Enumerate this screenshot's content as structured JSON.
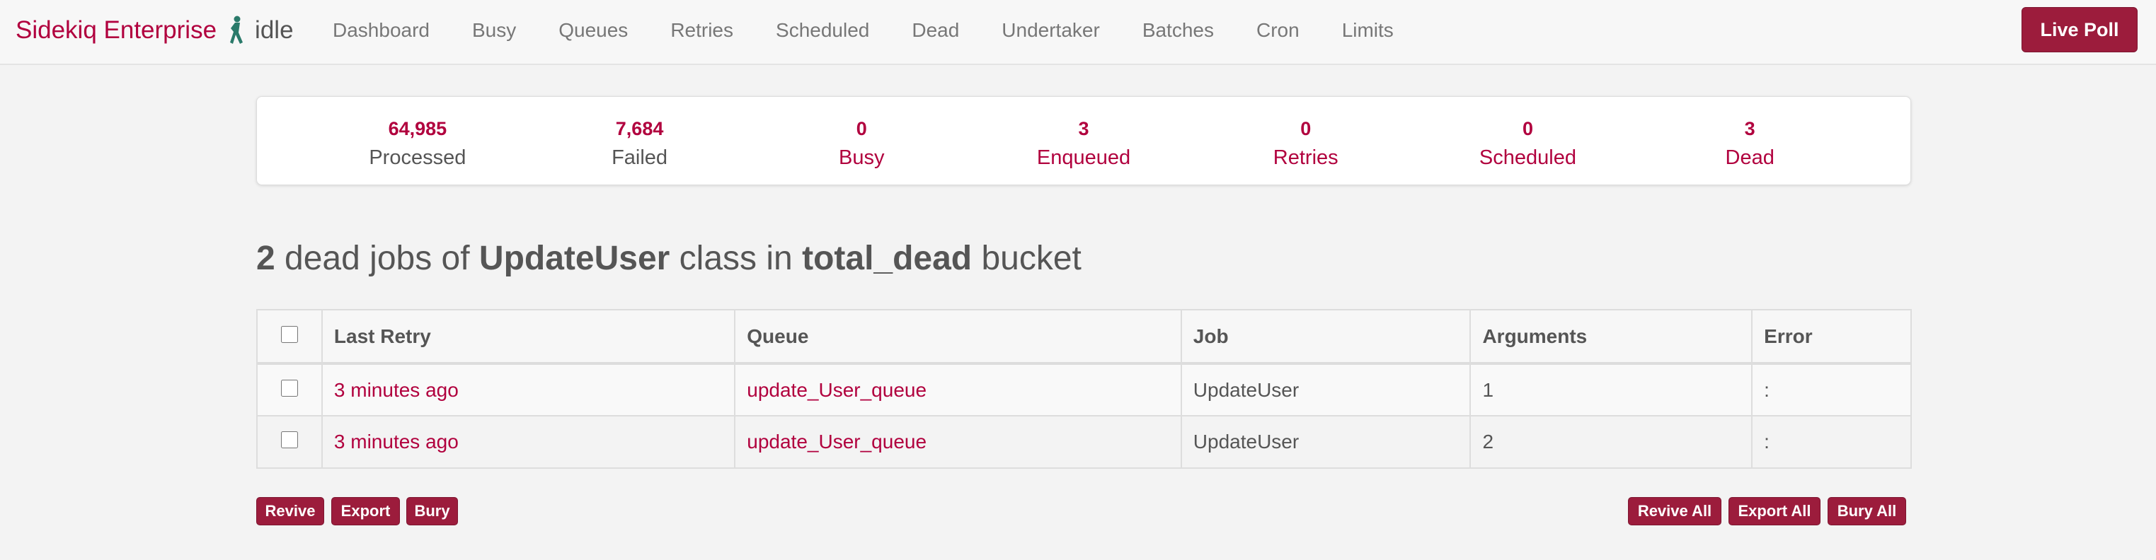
{
  "brand": {
    "name": "Sidekiq Enterprise",
    "status": "idle"
  },
  "nav": {
    "items": [
      "Dashboard",
      "Busy",
      "Queues",
      "Retries",
      "Scheduled",
      "Dead",
      "Undertaker",
      "Batches",
      "Cron",
      "Limits"
    ],
    "live_poll": "Live Poll"
  },
  "summary": [
    {
      "count": "64,985",
      "label": "Processed"
    },
    {
      "count": "7,684",
      "label": "Failed"
    },
    {
      "count": "0",
      "label": "Busy"
    },
    {
      "count": "3",
      "label": "Enqueued"
    },
    {
      "count": "0",
      "label": "Retries"
    },
    {
      "count": "0",
      "label": "Scheduled"
    },
    {
      "count": "3",
      "label": "Dead"
    }
  ],
  "heading": {
    "count": "2",
    "text1": " dead jobs of ",
    "klass": "UpdateUser",
    "text2": " class in ",
    "bucket": "total_dead",
    "text3": " bucket"
  },
  "table": {
    "columns": [
      "Last Retry",
      "Queue",
      "Job",
      "Arguments",
      "Error"
    ],
    "rows": [
      {
        "last_retry": "3 minutes ago",
        "queue": "update_User_queue",
        "job": "UpdateUser",
        "arguments": "1",
        "error": ":"
      },
      {
        "last_retry": "3 minutes ago",
        "queue": "update_User_queue",
        "job": "UpdateUser",
        "arguments": "2",
        "error": ":"
      }
    ]
  },
  "actions": {
    "revive": "Revive",
    "export": "Export",
    "bury": "Bury",
    "revive_all": "Revive All",
    "export_all": "Export All",
    "bury_all": "Bury All"
  },
  "colors": {
    "accent": "#b1003e",
    "button": "#9c1c3c",
    "logo_figure": "#2a7a6a"
  },
  "icons": {
    "logo": "sidekiq-figure-icon"
  }
}
